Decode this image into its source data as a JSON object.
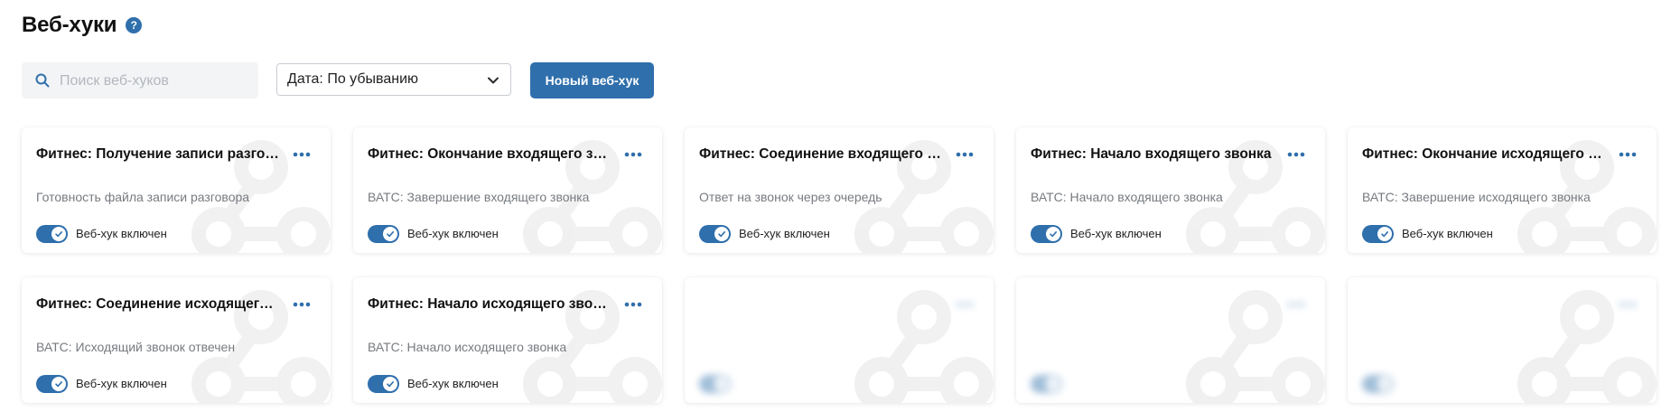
{
  "header": {
    "title": "Веб-хуки",
    "help_icon": "question-icon",
    "help_symbol": "?"
  },
  "search": {
    "placeholder": "Поиск веб-хуков",
    "value": "",
    "icon": "search-icon"
  },
  "sort": {
    "selected": "Дата: По убыванию",
    "icon": "chevron-down-icon"
  },
  "toolbar": {
    "new_label": "Новый веб-хук"
  },
  "colors": {
    "accent": "#2f6fac",
    "muted_text": "#777b80"
  },
  "cards": [
    {
      "title": "Фитнес: Получение записи разговора",
      "description": "Готовность файла записи разговора",
      "toggle_label": "Веб-хук включен",
      "enabled": true
    },
    {
      "title": "Фитнес: Окончание входящего звонка",
      "description": "ВАТС: Завершение входящего звонка",
      "toggle_label": "Веб-хук включен",
      "enabled": true
    },
    {
      "title": "Фитнес: Соединение входящего звонка",
      "description": "Ответ на звонок через очередь",
      "toggle_label": "Веб-хук включен",
      "enabled": true
    },
    {
      "title": "Фитнес: Начало входящего звонка",
      "description": "ВАТС: Начало входящего звонка",
      "toggle_label": "Веб-хук включен",
      "enabled": true
    },
    {
      "title": "Фитнес: Окончание исходящего звонка",
      "description": "ВАТС: Завершение исходящего звонка",
      "toggle_label": "Веб-хук включен",
      "enabled": true
    },
    {
      "title": "Фитнес: Соединение исходящего звонка",
      "description": "ВАТС: Исходящий звонок отвечен",
      "toggle_label": "Веб-хук включен",
      "enabled": true
    },
    {
      "title": "Фитнес: Начало исходящего звонка",
      "description": "ВАТС: Начало исходящего звонка",
      "toggle_label": "Веб-хук включен",
      "enabled": true
    },
    {
      "title": "",
      "description": "",
      "toggle_label": "",
      "enabled": true
    },
    {
      "title": "",
      "description": "",
      "toggle_label": "",
      "enabled": true
    },
    {
      "title": "",
      "description": "",
      "toggle_label": "",
      "enabled": true
    }
  ]
}
